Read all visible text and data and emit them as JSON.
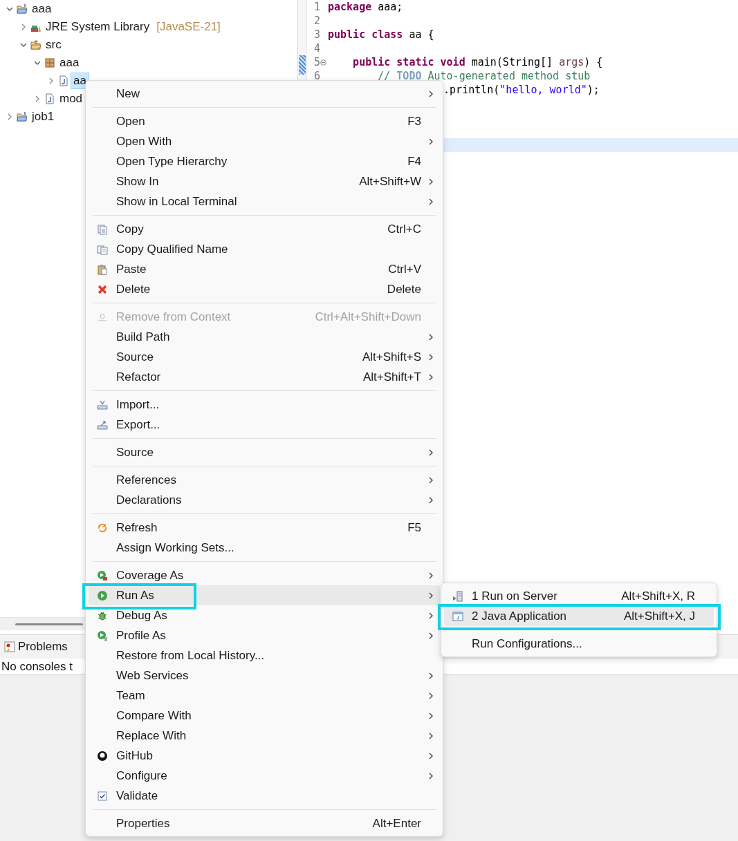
{
  "project_explorer": {
    "tree": [
      {
        "kind": "project",
        "label": "aaa",
        "expanded": true,
        "selected": false,
        "children": [
          {
            "kind": "library",
            "label": "JRE System Library",
            "decoration": "[JavaSE-21]",
            "expanded": false,
            "selected": false
          },
          {
            "kind": "source_folder",
            "label": "src",
            "expanded": true,
            "selected": false,
            "children": [
              {
                "kind": "package",
                "label": "aaa",
                "expanded": true,
                "selected": false,
                "children": [
                  {
                    "kind": "file",
                    "label": "aa",
                    "expanded": false,
                    "selected": true
                  }
                ]
              },
              {
                "kind": "file",
                "label": "mod",
                "expanded": false,
                "selected": false
              }
            ]
          }
        ]
      },
      {
        "kind": "project",
        "label": "job1",
        "expanded": false,
        "selected": false
      }
    ]
  },
  "editor": {
    "lines": [
      {
        "number": "1",
        "current": false,
        "tokens": [
          {
            "kind": "keyword",
            "text": "package"
          },
          {
            "kind": "plain",
            "text": " aaa;"
          }
        ]
      },
      {
        "number": "2",
        "current": false
      },
      {
        "number": "3",
        "current": false,
        "tokens": [
          {
            "kind": "keyword",
            "text": "public class"
          },
          {
            "kind": "plain",
            "text": " aa {"
          }
        ]
      },
      {
        "number": "4",
        "current": false
      },
      {
        "number": "5",
        "current": false,
        "folding": true,
        "tokens": [
          {
            "kind": "keyword",
            "text": "    public static void"
          },
          {
            "kind": "plain",
            "text": " main(String[] "
          },
          {
            "kind": "param",
            "text": "args"
          },
          {
            "kind": "plain",
            "text": ") {"
          }
        ]
      },
      {
        "number": "6",
        "current": false,
        "tokens": [
          {
            "kind": "comment",
            "text": "        // "
          },
          {
            "kind": "todo",
            "text": "TODO"
          },
          {
            "kind": "comment",
            "text": " Auto-generated method stub"
          }
        ]
      },
      {
        "current": false,
        "tokens": [
          {
            "kind": "plain",
            "text": ".println("
          },
          {
            "kind": "string",
            "text": "\"hello, world\""
          },
          {
            "kind": "plain",
            "text": ");"
          }
        ]
      },
      {
        "current": false
      },
      {
        "current": false
      },
      {
        "current": false
      },
      {
        "current": true
      }
    ]
  },
  "bottom_panel": {
    "tabs": [
      {
        "label": "Problems"
      }
    ],
    "message": "No consoles t"
  },
  "context_menu": {
    "groups": [
      [
        {
          "label": "New",
          "has_submenu": true,
          "disabled": false,
          "selected": false,
          "annotated": false
        }
      ],
      [
        {
          "label": "Open",
          "shortcut": "F3",
          "has_submenu": false,
          "disabled": false,
          "selected": false,
          "annotated": false
        },
        {
          "label": "Open With",
          "has_submenu": true,
          "disabled": false,
          "selected": false,
          "annotated": false
        },
        {
          "label": "Open Type Hierarchy",
          "shortcut": "F4",
          "has_submenu": false,
          "disabled": false,
          "selected": false,
          "annotated": false
        },
        {
          "label": "Show In",
          "shortcut": "Alt+Shift+W",
          "has_submenu": true,
          "disabled": false,
          "selected": false,
          "annotated": false
        },
        {
          "label": "Show in Local Terminal",
          "has_submenu": true,
          "disabled": false,
          "selected": false,
          "annotated": false
        }
      ],
      [
        {
          "label": "Copy",
          "shortcut": "Ctrl+C",
          "has_submenu": false,
          "disabled": false,
          "selected": false,
          "annotated": false
        },
        {
          "label": "Copy Qualified Name",
          "has_submenu": false,
          "disabled": false,
          "selected": false,
          "annotated": false
        },
        {
          "label": "Paste",
          "shortcut": "Ctrl+V",
          "has_submenu": false,
          "disabled": false,
          "selected": false,
          "annotated": false
        },
        {
          "label": "Delete",
          "shortcut": "Delete",
          "has_submenu": false,
          "disabled": false,
          "selected": false,
          "annotated": false
        }
      ],
      [
        {
          "label": "Remove from Context",
          "shortcut": "Ctrl+Alt+Shift+Down",
          "has_submenu": false,
          "disabled": true,
          "selected": false,
          "annotated": false
        },
        {
          "label": "Build Path",
          "has_submenu": true,
          "disabled": false,
          "selected": false,
          "annotated": false
        },
        {
          "label": "Source",
          "shortcut": "Alt+Shift+S",
          "has_submenu": true,
          "disabled": false,
          "selected": false,
          "annotated": false
        },
        {
          "label": "Refactor",
          "shortcut": "Alt+Shift+T",
          "has_submenu": true,
          "disabled": false,
          "selected": false,
          "annotated": false
        }
      ],
      [
        {
          "label": "Import...",
          "has_submenu": false,
          "disabled": false,
          "selected": false,
          "annotated": false
        },
        {
          "label": "Export...",
          "has_submenu": false,
          "disabled": false,
          "selected": false,
          "annotated": false
        }
      ],
      [
        {
          "label": "Source",
          "has_submenu": true,
          "disabled": false,
          "selected": false,
          "annotated": false
        }
      ],
      [
        {
          "label": "References",
          "has_submenu": true,
          "disabled": false,
          "selected": false,
          "annotated": false
        },
        {
          "label": "Declarations",
          "has_submenu": true,
          "disabled": false,
          "selected": false,
          "annotated": false
        }
      ],
      [
        {
          "label": "Refresh",
          "shortcut": "F5",
          "has_submenu": false,
          "disabled": false,
          "selected": false,
          "annotated": false
        },
        {
          "label": "Assign Working Sets...",
          "has_submenu": false,
          "disabled": false,
          "selected": false,
          "annotated": false
        }
      ],
      [
        {
          "label": "Coverage As",
          "has_submenu": true,
          "disabled": false,
          "selected": false,
          "annotated": false
        },
        {
          "label": "Run As",
          "has_submenu": true,
          "disabled": false,
          "selected": true,
          "annotated": true
        },
        {
          "label": "Debug As",
          "has_submenu": true,
          "disabled": false,
          "selected": false,
          "annotated": false
        },
        {
          "label": "Profile As",
          "has_submenu": true,
          "disabled": false,
          "selected": false,
          "annotated": false
        },
        {
          "label": "Restore from Local History...",
          "has_submenu": false,
          "disabled": false,
          "selected": false,
          "annotated": false
        },
        {
          "label": "Web Services",
          "has_submenu": true,
          "disabled": false,
          "selected": false,
          "annotated": false
        },
        {
          "label": "Team",
          "has_submenu": true,
          "disabled": false,
          "selected": false,
          "annotated": false
        },
        {
          "label": "Compare With",
          "has_submenu": true,
          "disabled": false,
          "selected": false,
          "annotated": false
        },
        {
          "label": "Replace With",
          "has_submenu": true,
          "disabled": false,
          "selected": false,
          "annotated": false
        },
        {
          "label": "GitHub",
          "has_submenu": true,
          "disabled": false,
          "selected": false,
          "annotated": false
        },
        {
          "label": "Configure",
          "has_submenu": true,
          "disabled": false,
          "selected": false,
          "annotated": false
        },
        {
          "label": "Validate",
          "has_submenu": false,
          "disabled": false,
          "selected": false,
          "annotated": false
        }
      ],
      [
        {
          "label": "Properties",
          "shortcut": "Alt+Enter",
          "has_submenu": false,
          "disabled": false,
          "selected": false,
          "annotated": false
        }
      ]
    ]
  },
  "submenu": {
    "groups": [
      [
        {
          "label": "1 Run on Server",
          "shortcut": "Alt+Shift+X, R",
          "has_submenu": false,
          "disabled": false,
          "selected": false,
          "annotated": false
        },
        {
          "label": "2 Java Application",
          "shortcut": "Alt+Shift+X, J",
          "has_submenu": false,
          "disabled": false,
          "selected": true,
          "annotated": true
        }
      ],
      [
        {
          "label": "Run Configurations...",
          "has_submenu": false,
          "disabled": false,
          "selected": false,
          "annotated": false
        }
      ]
    ]
  }
}
